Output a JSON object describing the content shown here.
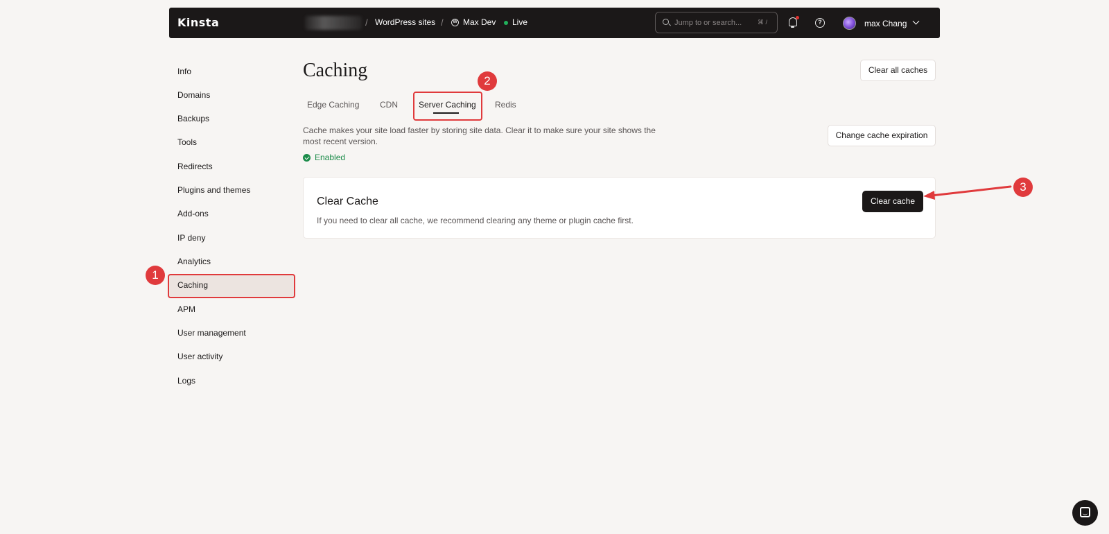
{
  "topbar": {
    "logo": "Kinsta",
    "separator": "/",
    "crumb_sites": "WordPress sites",
    "crumb_site": "Max Dev",
    "crumb_env": "Live",
    "search_placeholder": "Jump to or search...",
    "search_shortcut": "⌘ /",
    "help_glyph": "?",
    "wp_glyph": "W",
    "username": "max Chang"
  },
  "sidebar": {
    "items": [
      {
        "label": "Info"
      },
      {
        "label": "Domains"
      },
      {
        "label": "Backups"
      },
      {
        "label": "Tools"
      },
      {
        "label": "Redirects"
      },
      {
        "label": "Plugins and themes"
      },
      {
        "label": "Add-ons"
      },
      {
        "label": "IP deny"
      },
      {
        "label": "Analytics"
      },
      {
        "label": "Caching",
        "active": true
      },
      {
        "label": "APM"
      },
      {
        "label": "User management"
      },
      {
        "label": "User activity"
      },
      {
        "label": "Logs"
      }
    ]
  },
  "main": {
    "title": "Caching",
    "clear_all_label": "Clear all caches",
    "tabs": [
      {
        "label": "Edge Caching"
      },
      {
        "label": "CDN"
      },
      {
        "label": "Server Caching",
        "active": true
      },
      {
        "label": "Redis"
      }
    ],
    "description": "Cache makes your site load faster by storing site data. Clear it to make sure your site shows the most recent version.",
    "change_expiration_label": "Change cache expiration",
    "status": "Enabled",
    "card": {
      "title": "Clear Cache",
      "description": "If you need to clear all cache, we recommend clearing any theme or plugin cache first.",
      "button_label": "Clear cache"
    }
  },
  "annotations": {
    "step1": "1",
    "step2": "2",
    "step3": "3",
    "color": "#e03a3c"
  },
  "colors": {
    "topbar_bg": "#1b1818",
    "page_bg": "#f7f5f3",
    "status_green": "#1c8c4a",
    "live_green": "#21b05b"
  }
}
